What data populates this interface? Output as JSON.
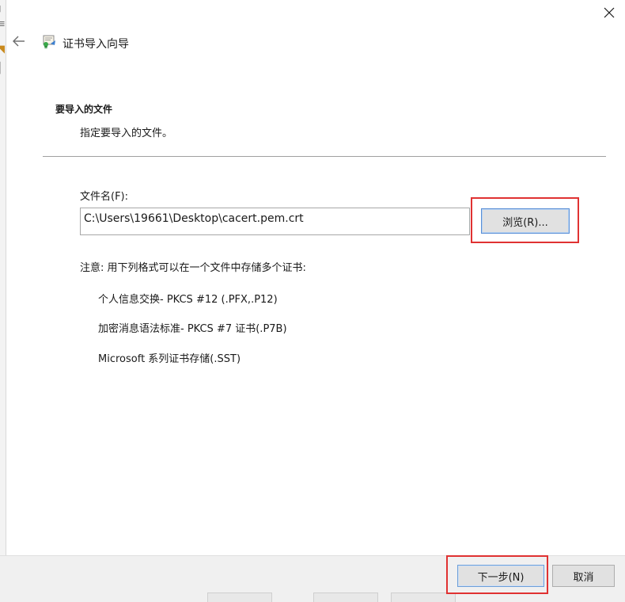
{
  "window": {
    "title": "证书导入向导",
    "icons": {
      "close": "close-icon",
      "back": "back-arrow-icon",
      "wizard": "certificate-icon"
    }
  },
  "section": {
    "heading": "要导入的文件",
    "subheading": "指定要导入的文件。"
  },
  "file": {
    "label": "文件名(F):",
    "value": "C:\\Users\\19661\\Desktop\\cacert.pem.crt",
    "browse_label": "浏览(R)..."
  },
  "note": {
    "text": "注意: 用下列格式可以在一个文件中存储多个证书:",
    "formats": [
      "个人信息交换- PKCS #12 (.PFX,.P12)",
      "加密消息语法标准- PKCS #7 证书(.P7B)",
      "Microsoft 系列证书存储(.SST)"
    ]
  },
  "footer": {
    "next_label": "下一步(N)",
    "cancel_label": "取消"
  },
  "colors": {
    "highlight": "#e03232",
    "button_focus": "#5a8fd6",
    "footer_bg": "#f0f0f0"
  }
}
